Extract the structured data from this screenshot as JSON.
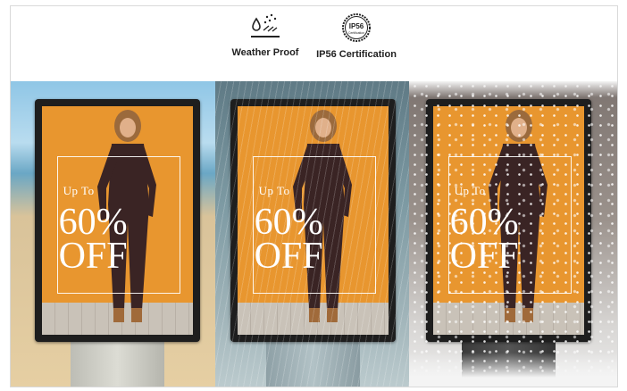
{
  "features": [
    {
      "label": "Weather Proof",
      "icon": "weather-proof-icon"
    },
    {
      "label": "IP56 Certification",
      "icon": "ip56-badge-icon",
      "badge_text": "IP56",
      "badge_subtext": "Certification"
    }
  ],
  "kiosks": [
    {
      "scene": "beach",
      "line1": "Up To",
      "line2": "60%",
      "line3": "OFF"
    },
    {
      "scene": "rain",
      "line1": "Up To",
      "line2": "60%",
      "line3": "OFF"
    },
    {
      "scene": "snow",
      "line1": "Up To",
      "line2": "60%",
      "line3": "OFF"
    }
  ],
  "colors": {
    "screen": "#e8962f",
    "bezel": "#1e1e1e",
    "promo_text": "#ffffff",
    "label_text": "#222222"
  }
}
